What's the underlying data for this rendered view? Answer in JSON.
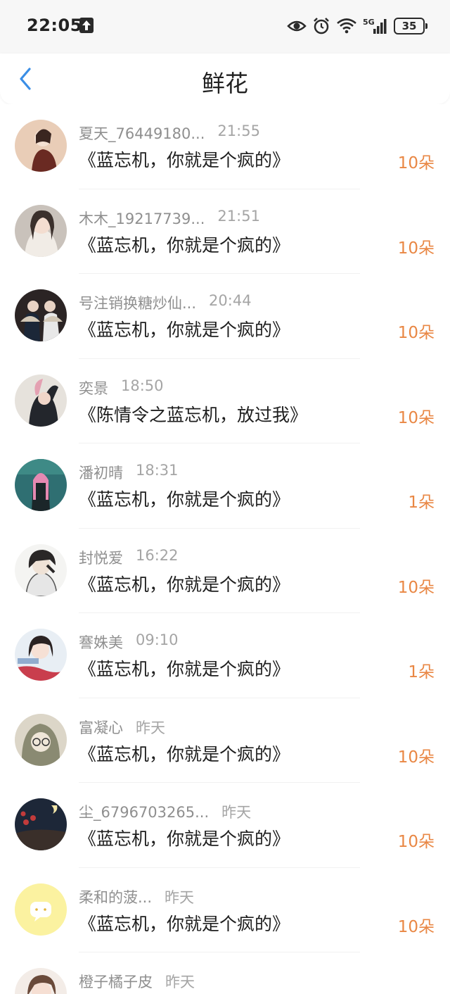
{
  "status_bar": {
    "time": "22:05",
    "battery": "35",
    "icons": [
      "upload-icon",
      "eye-icon",
      "alarm-icon",
      "wifi-icon",
      "signal-5g-icon",
      "battery-icon"
    ]
  },
  "nav": {
    "title": "鲜花",
    "back_icon": "chevron-left-icon"
  },
  "colors": {
    "accent": "#3a8ee6",
    "count": "#e98744",
    "name": "#8f8f8f"
  },
  "items": [
    {
      "name": "夏天_76449180...",
      "time": "21:55",
      "title": "《蓝忘机，你就是个疯的》",
      "count": "10朵"
    },
    {
      "name": "木木_19217739...",
      "time": "21:51",
      "title": "《蓝忘机，你就是个疯的》",
      "count": "10朵"
    },
    {
      "name": "号注销换糖炒仙...",
      "time": "20:44",
      "title": "《蓝忘机，你就是个疯的》",
      "count": "10朵"
    },
    {
      "name": "奕景",
      "time": "18:50",
      "title": "《陈情令之蓝忘机，放过我》",
      "count": "10朵"
    },
    {
      "name": "潘初晴",
      "time": "18:31",
      "title": "《蓝忘机，你就是个疯的》",
      "count": "1朵"
    },
    {
      "name": "封悦爱",
      "time": "16:22",
      "title": "《蓝忘机，你就是个疯的》",
      "count": "10朵"
    },
    {
      "name": "謇姝美",
      "time": "09:10",
      "title": "《蓝忘机，你就是个疯的》",
      "count": "1朵"
    },
    {
      "name": "富凝心",
      "time": "昨天",
      "title": "《蓝忘机，你就是个疯的》",
      "count": "10朵"
    },
    {
      "name": "尘_6796703265...",
      "time": "昨天",
      "title": "《蓝忘机，你就是个疯的》",
      "count": "10朵"
    },
    {
      "name": "柔和的菠...",
      "time": "昨天",
      "title": "《蓝忘机，你就是个疯的》",
      "count": "10朵"
    },
    {
      "name": "橙子橘子皮",
      "time": "昨天",
      "title": "",
      "count": ""
    }
  ]
}
